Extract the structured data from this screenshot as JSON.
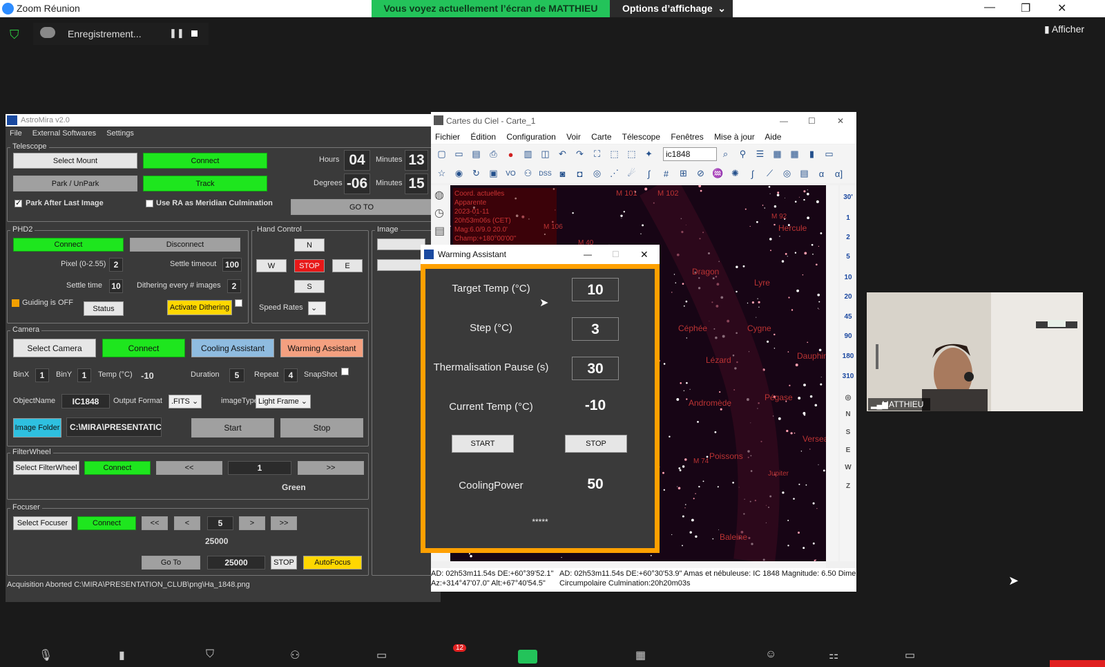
{
  "zoom": {
    "title": "Zoom Réunion",
    "share_banner": "Vous voyez actuellement l’écran de MATTHIEU",
    "view_options": "Options d’affichage",
    "recording": "Enregistrement...",
    "show": "Afficher",
    "participant_name": "MATTHIEU",
    "chat_badge": "12"
  },
  "astromira": {
    "title": "AstroMira v2.0",
    "menu": [
      "File",
      "External Softwares",
      "Settings"
    ],
    "telescope": {
      "group": "Telescope",
      "select_mount": "Select Mount",
      "connect": "Connect",
      "park": "Park / UnPark",
      "track": "Track",
      "hours_label": "Hours",
      "hours": "04",
      "minutes_label": "Minutes",
      "minutes_ra": "13",
      "degrees_label": "Degrees",
      "degrees": "-06",
      "minutes_dec": "15",
      "park_after_last": "Park After Last Image",
      "use_ra_meridian": "Use RA as Meridian Culmination",
      "goto": "GO TO"
    },
    "phd2": {
      "group": "PHD2",
      "connect": "Connect",
      "disconnect": "Disconnect",
      "pixel_label": "Pixel (0-2.55)",
      "pixel": "2",
      "settle_timeout_label": "Settle timeout",
      "settle_timeout": "100",
      "settle_time_label": "Settle time",
      "settle_time": "10",
      "dither_every_label": "Dithering every # images",
      "dither_every": "2",
      "guiding_status": "Guiding is OFF",
      "status_btn": "Status",
      "activate_dithering": "Activate Dithering"
    },
    "hand_control": {
      "group": "Hand Control",
      "n": "N",
      "w": "W",
      "stop": "STOP",
      "e": "E",
      "s": "S",
      "speed_rates": "Speed Rates"
    },
    "image_group": "Image",
    "camera": {
      "group": "Camera",
      "select_camera": "Select Camera",
      "connect": "Connect",
      "cooling": "Cooling Assistant",
      "warming": "Warming Assistant",
      "binx_label": "BinX",
      "binx": "1",
      "biny_label": "BinY",
      "biny": "1",
      "temp_label": "Temp (°C)",
      "temp": "-10",
      "duration_label": "Duration",
      "duration": "5",
      "repeat_label": "Repeat",
      "repeat": "4",
      "snapshot_label": "SnapShot",
      "objectname_label": "ObjectName",
      "objectname": "IC1848",
      "output_format_label": "Output Format",
      "output_format": ".FITS",
      "imagetype_label": "imageType",
      "imagetype": "Light Frame",
      "image_folder": "Image Folder",
      "folder_path": "C:\\MIRA\\PRESENTATIC",
      "start": "Start",
      "stop": "Stop"
    },
    "filterwheel": {
      "group": "FilterWheel",
      "select": "Select FilterWheel",
      "connect": "Connect",
      "prev": "<<",
      "position": "1",
      "next": ">>",
      "filter_name": "Green"
    },
    "focuser": {
      "group": "Focuser",
      "select": "Select Focuser",
      "connect": "Connect",
      "ff_back": "<<",
      "back": "<",
      "step": "5",
      "fwd": ">",
      "ff_fwd": ">>",
      "position": "25000",
      "goto": "Go To",
      "goto_value": "25000",
      "stop": "STOP",
      "autofocus": "AutoFocus"
    },
    "status_line": "Acquisition Aborted  C:\\MIRA\\PRESENTATION_CLUB\\png\\Ha_1848.png"
  },
  "cdc": {
    "title": "Cartes du Ciel - Carte_1",
    "menu": [
      "Fichier",
      "Édition",
      "Configuration",
      "Voir",
      "Carte",
      "Télescope",
      "Fenêtres",
      "Mise à jour",
      "Aide"
    ],
    "search_value": "ic1848",
    "zoom_scale": [
      "30'",
      "1",
      "2",
      "5",
      "10",
      "20",
      "45",
      "90",
      "180",
      "310"
    ],
    "compass": [
      "N",
      "S",
      "E",
      "W",
      "Z"
    ],
    "sky_labels": [
      "M 101",
      "M 102",
      "Hercule",
      "Dragon",
      "Lyre",
      "Céphée",
      "Cygne",
      "Dauphin",
      "Lézard",
      "Andromède",
      "Pégase",
      "Poissons",
      "Verseau",
      "Baleine",
      "Jupiter",
      "M 92",
      "M 106",
      "M 40",
      "M 74"
    ],
    "info_overlay": [
      "Coord. actuelles",
      "Apparente",
      "2023-01-11",
      "20h53m06s (CET)",
      "Mag:6.0/9.0 20.0'",
      "Champ:+180°00'00\""
    ],
    "status_left_1": "AD: 02h53m11.54s DE:+60°39'52.1\"",
    "status_left_2": "Az:+314°47'07.0\" Alt:+67°40'54.5\"",
    "status_right_1": "AD: 02h53m11.54s DE:+60°30'53.9\"  Amas et nébuleuse: IC 1848  Magnitude: 6.50  Dimens",
    "status_right_2": "Circumpolaire   Culmination:20h20m03s"
  },
  "warming": {
    "title": "Warming Assistant",
    "target_label": "Target Temp (°C)",
    "target": "10",
    "step_label": "Step (°C)",
    "step": "3",
    "pause_label": "Thermalisation Pause (s)",
    "pause": "30",
    "current_label": "Current Temp (°C)",
    "current": "-10",
    "start": "START",
    "stop": "STOP",
    "power_label": "CoolingPower",
    "power": "50",
    "stars": "*****"
  }
}
